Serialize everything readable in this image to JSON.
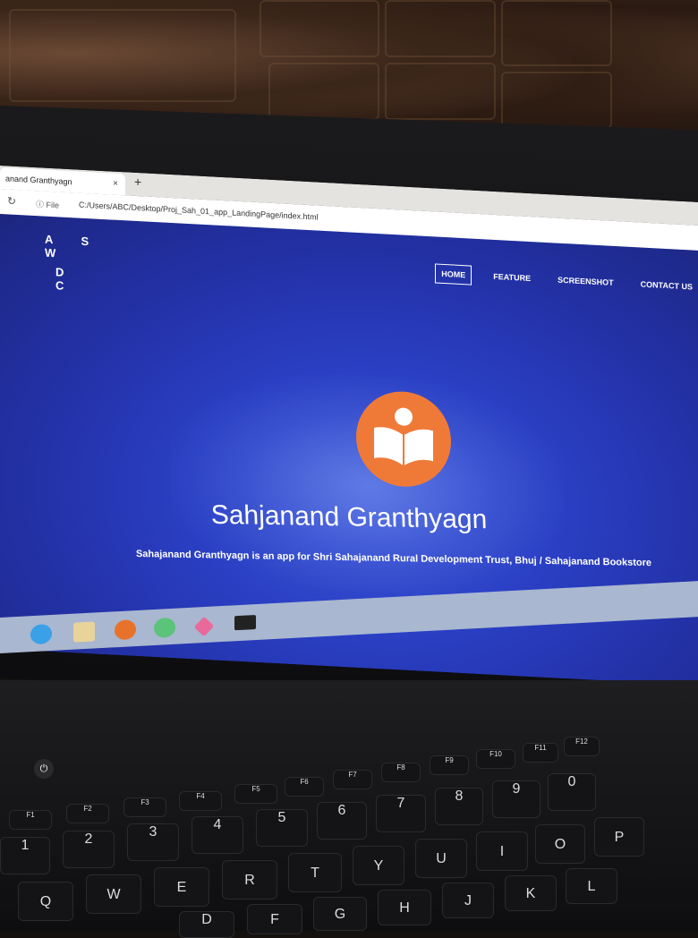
{
  "browser": {
    "tab_title": "anand Granthyagn",
    "tab_close": "×",
    "new_tab": "+",
    "address_info": "ⓘ File",
    "url": "C:/Users/ABC/Desktop/Proj_Sah_01_app_LandingPage/index.html"
  },
  "site": {
    "logo_row1": "A S W",
    "logo_row2": "D C",
    "nav": [
      "HOME",
      "FEATURE",
      "SCREENSHOT",
      "CONTACT US"
    ],
    "title": "Sahjanand Granthyagn",
    "subtitle": "Sahajanand Granthyagn is an app for Shri Sahajanand Rural Development Trust, Bhuj / Sahajanand Bookstore",
    "emblem_color": "#ef7a38",
    "background_color": "#2a3fc4"
  },
  "keyboard": {
    "row_fn": [
      "F1",
      "F2",
      "F3",
      "F4",
      "F5",
      "F6",
      "F7",
      "F8",
      "F9",
      "F10",
      "F11",
      "F12"
    ],
    "row_num": [
      "1",
      "2",
      "3",
      "4",
      "5",
      "6",
      "7",
      "8",
      "9",
      "0"
    ],
    "row_q": [
      "Q",
      "W",
      "E",
      "R",
      "T",
      "Y",
      "U",
      "I",
      "O",
      "P"
    ],
    "row_a": [
      "D",
      "F",
      "G",
      "H",
      "J",
      "K",
      "L"
    ]
  }
}
